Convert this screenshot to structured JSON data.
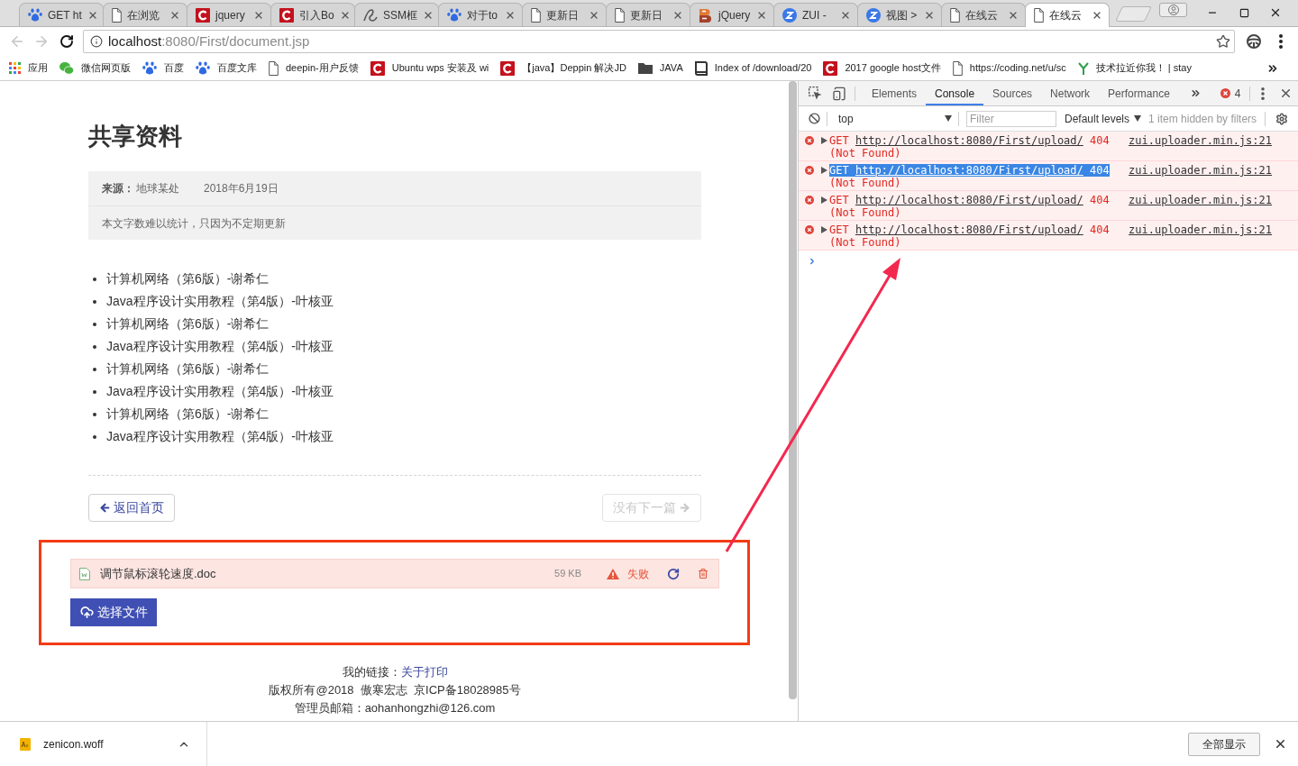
{
  "browser": {
    "tabs": [
      {
        "title": "GET ht",
        "kind": "paw",
        "selected": false
      },
      {
        "title": "在浏览",
        "kind": "page",
        "selected": false
      },
      {
        "title": "jquery",
        "kind": "c-logo",
        "selected": false
      },
      {
        "title": "引入Bo",
        "kind": "c-logo",
        "selected": false
      },
      {
        "title": "SSM框",
        "kind": "swirl",
        "selected": false
      },
      {
        "title": "对于to",
        "kind": "paw",
        "selected": false
      },
      {
        "title": "更新日",
        "kind": "page",
        "selected": false
      },
      {
        "title": "更新日",
        "kind": "page",
        "selected": false
      },
      {
        "title": "jQuery",
        "kind": "logo",
        "selected": false
      },
      {
        "title": "ZUI -",
        "kind": "z-badge",
        "selected": false
      },
      {
        "title": "视图 >",
        "kind": "z-badge",
        "selected": false
      },
      {
        "title": "在线云",
        "kind": "page",
        "selected": false
      },
      {
        "title": "在线云",
        "kind": "page",
        "selected": true
      }
    ],
    "back_disabled": true,
    "forward_disabled": true,
    "url": {
      "host": "localhost",
      "path": ":8080/First/document.jsp"
    },
    "bookmarks": [
      {
        "label": "应用",
        "kind": "grid"
      },
      {
        "label": "微信网页版",
        "kind": "chat"
      },
      {
        "label": "百度",
        "kind": "paw"
      },
      {
        "label": "百度文库",
        "kind": "paw"
      },
      {
        "label": "deepin-用户反馈",
        "kind": "page"
      },
      {
        "label": "Ubuntu wps 安装及 wi",
        "kind": "c-logo"
      },
      {
        "label": "【java】Deppin 解决JD",
        "kind": "c-logo"
      },
      {
        "label": "JAVA",
        "kind": "folder"
      },
      {
        "label": "Index of /download/20",
        "kind": "book"
      },
      {
        "label": "2017 google host文件",
        "kind": "c-logo"
      },
      {
        "label": "https://coding.net/u/sc",
        "kind": "page"
      },
      {
        "label": "技术拉近你我！ | stay",
        "kind": "y-logo"
      }
    ]
  },
  "page": {
    "title": "共享资料",
    "meta": {
      "source_label": "来源：",
      "source": "地球某处",
      "date": "2018年6月19日",
      "note": "本文字数难以统计，只因为不定期更新"
    },
    "items": [
      "计算机网络（第6版）-谢希仁",
      "Java程序设计实用教程（第4版）-叶核亚",
      "计算机网络（第6版）-谢希仁",
      "Java程序设计实用教程（第4版）-叶核亚",
      "计算机网络（第6版）-谢希仁",
      "Java程序设计实用教程（第4版）-叶核亚",
      "计算机网络（第6版）-谢希仁",
      "Java程序设计实用教程（第4版）-叶核亚"
    ],
    "nav": [
      {
        "label": "返回首页",
        "kind": "back",
        "disabled": false
      },
      {
        "label": "没有下一篇",
        "kind": "next",
        "disabled": true
      }
    ],
    "uploader": {
      "files": [
        {
          "name": "调节鼠标滚轮速度.doc",
          "size": "59 KB",
          "status": "失败",
          "failed": true
        }
      ],
      "button": "选择文件"
    },
    "footer": {
      "label": "我的链接：",
      "link": "关于打印",
      "copyright": "版权所有@2018  傲寒宏志  京ICP备18028985号",
      "email": "管理员邮箱：aohanhongzhi@126.com"
    }
  },
  "devtools": {
    "tabs": [
      {
        "label": "Elements",
        "selected": false
      },
      {
        "label": "Console",
        "selected": true
      },
      {
        "label": "Sources",
        "selected": false
      },
      {
        "label": "Network",
        "selected": false
      },
      {
        "label": "Performance",
        "selected": false
      }
    ],
    "error_count": "4",
    "context": "top",
    "filter": {
      "placeholder": "Filter"
    },
    "levels": "Default levels",
    "hidden_note": "1 item hidden by filters",
    "messages": [
      {
        "method": "GET",
        "url": "http://localhost:8080/First/upload/",
        "status": "404",
        "status_text": "(Not Found)",
        "source": "zui.uploader.min.js:21",
        "selected": false
      },
      {
        "method": "GET",
        "url": "http://localhost:8080/First/upload/",
        "status": "404",
        "status_text": "(Not Found)",
        "source": "zui.uploader.min.js:21",
        "selected": true
      },
      {
        "method": "GET",
        "url": "http://localhost:8080/First/upload/",
        "status": "404",
        "status_text": "(Not Found)",
        "source": "zui.uploader.min.js:21",
        "selected": false
      },
      {
        "method": "GET",
        "url": "http://localhost:8080/First/upload/",
        "status": "404",
        "status_text": "(Not Found)",
        "source": "zui.uploader.min.js:21",
        "selected": false
      }
    ]
  },
  "downloads": {
    "items": [
      {
        "name": "zenicon.woff"
      }
    ],
    "show_all": "全部显示"
  }
}
